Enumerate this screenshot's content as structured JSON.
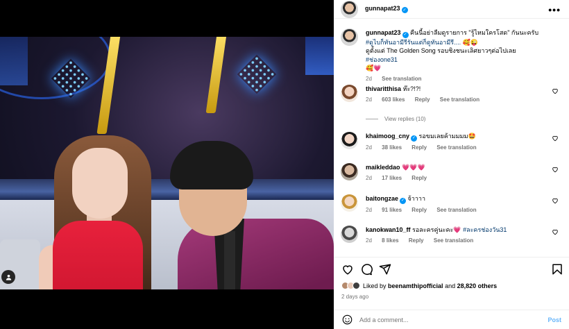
{
  "colors": {
    "accent": "#0095f6",
    "hashtag": "#00376b",
    "muted": "#737373",
    "like_heart": "#ed4956",
    "post_disabled": "#67b5fa"
  },
  "post_header": {
    "username": "gunnapat23",
    "more_icon": "more-horizontal-icon"
  },
  "caption": {
    "username": "gunnapat23",
    "text_1": "คืนนี้อย่าลืมดูรายการ \"รู้ไหมใครโสด\" กันนะครับ",
    "hashtag_1": "#ดูไบก็ทันอามีรีรันแต่ก็ดูทันอามีรี....",
    "emoji_1": "🥰😜",
    "text_2": "ดูตั้งแต่ The Golden Song รอบชิงชนะเลิศยาวๆต่อไปเลย",
    "hashtag_2": "#ช่องone31",
    "emoji_2": "🥰💗",
    "time": "2d",
    "see_translation": "See translation"
  },
  "comments": [
    {
      "username": "thivaritthisa",
      "verified": false,
      "text": "ห๊ะ?!?!",
      "time": "2d",
      "likes": "603 likes",
      "reply": "Reply",
      "see_translation": "See translation",
      "view_replies": "View replies (10)"
    },
    {
      "username": "khaimoog_cny",
      "verified": true,
      "text": "รอขมเลยค้ามมมม🤩",
      "time": "2d",
      "likes": "38 likes",
      "reply": "Reply",
      "see_translation": "See translation"
    },
    {
      "username": "maikleddao",
      "verified": false,
      "text": "💗💗💗",
      "time": "2d",
      "likes": "17 likes",
      "reply": "Reply"
    },
    {
      "username": "baitongzae",
      "verified": true,
      "text": "จ้าาาา",
      "time": "2d",
      "likes": "91 likes",
      "reply": "Reply",
      "see_translation": "See translation"
    },
    {
      "username": "kanokwan10_ff",
      "verified": false,
      "text": "รอละครคู่นะคะ💗",
      "hashtag": "#ละครช่องวัน31",
      "time": "2d",
      "likes": "8 likes",
      "reply": "Reply",
      "see_translation": "See translation"
    }
  ],
  "actions": {
    "like_icon": "heart-icon",
    "comment_icon": "comment-icon",
    "share_icon": "send-icon",
    "save_icon": "bookmark-icon"
  },
  "likes_line": {
    "prefix": "Liked by",
    "user": "beenamthipofficial",
    "and": "and",
    "others": "28,820 others"
  },
  "time_ago": "2 days ago",
  "add_comment": {
    "placeholder": "Add a comment...",
    "post_label": "Post",
    "emoji_icon": "smile-icon"
  },
  "media": {
    "tag_icon": "user-tag-icon"
  }
}
